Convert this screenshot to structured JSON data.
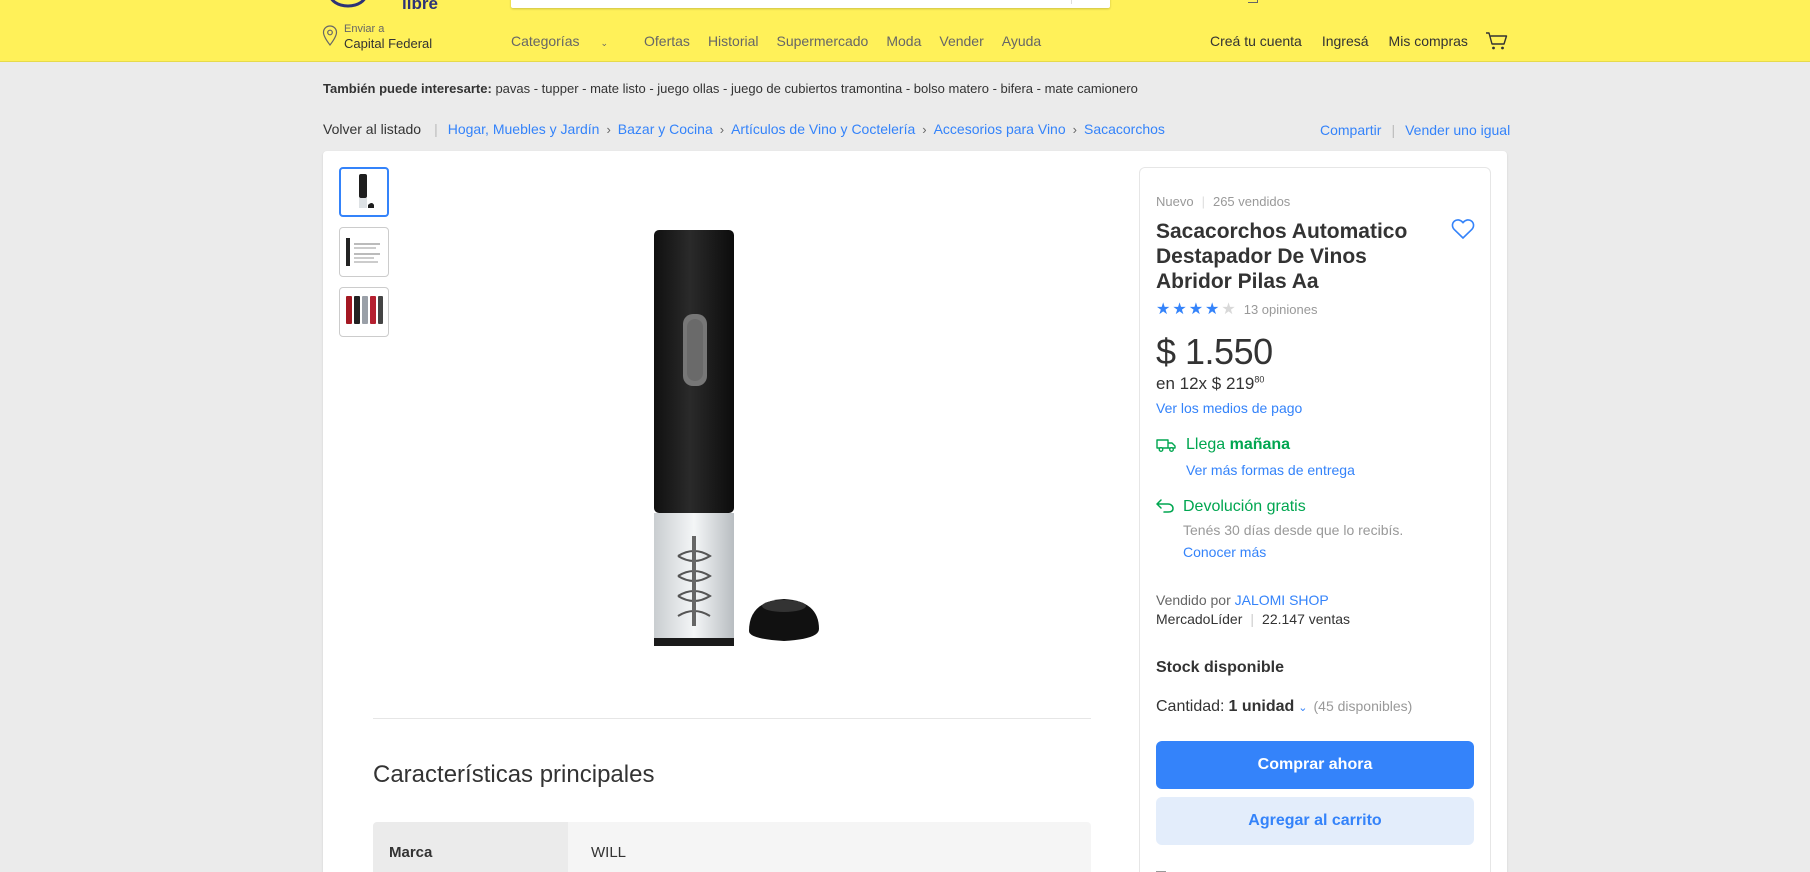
{
  "header": {
    "logo_text": "libre",
    "location_small": "Enviar a",
    "location_big": "Capital Federal",
    "nav": [
      "Categorías",
      "Ofertas",
      "Historial",
      "Supermercado",
      "Moda",
      "Vender",
      "Ayuda"
    ],
    "user_nav": [
      "Creá tu cuenta",
      "Ingresá",
      "Mis compras"
    ]
  },
  "interest": {
    "label": "También puede interesarte:",
    "items": "pavas - tupper - mate listo - juego ollas - juego de cubiertos tramontina - bolso matero - bifera - mate camionero"
  },
  "breadcrumb": {
    "back": "Volver al listado",
    "items": [
      "Hogar, Muebles y Jardín",
      "Bazar y Cocina",
      "Artículos de Vino y Coctelería",
      "Accesorios para Vino",
      "Sacacorchos"
    ],
    "share": "Compartir",
    "sell_same": "Vender uno igual"
  },
  "product": {
    "condition": "Nuevo",
    "sold": "265 vendidos",
    "title": "Sacacorchos Automatico Destapador De Vinos Abridor Pilas Aa",
    "rating_stars": 4,
    "rating_max": 5,
    "reviews": "13 opiniones",
    "price": "$ 1.550",
    "installments_prefix": "en 12x $ 219",
    "installments_cents": "80",
    "payment_link": "Ver los medios de pago",
    "shipping_prefix": "Llega ",
    "shipping_when": "mañana",
    "shipping_link": "Ver más formas de entrega",
    "returns_title": "Devolución gratis",
    "returns_sub": "Tenés 30 días desde que lo recibís.",
    "returns_link": "Conocer más",
    "seller_prefix": "Vendido por ",
    "seller_name": "JALOMI SHOP",
    "leader": "MercadoLíder",
    "sales": "22.147 ventas",
    "stock": "Stock disponible",
    "qty_label": "Cantidad:",
    "qty_value": "1 unidad",
    "qty_available": "(45 disponibles)",
    "buy_now": "Comprar ahora",
    "add_cart": "Agregar al carrito"
  },
  "features": {
    "title": "Características principales",
    "rows": [
      {
        "key": "Marca",
        "value": "WILL"
      }
    ]
  },
  "colors": {
    "header_bg": "#fff159",
    "accent": "#3483fa",
    "green": "#00a650"
  },
  "icons": [
    "location-pin-icon",
    "cart-icon",
    "heart-icon",
    "truck-icon",
    "return-arrow-icon",
    "star-icon",
    "chevron-down-icon"
  ]
}
